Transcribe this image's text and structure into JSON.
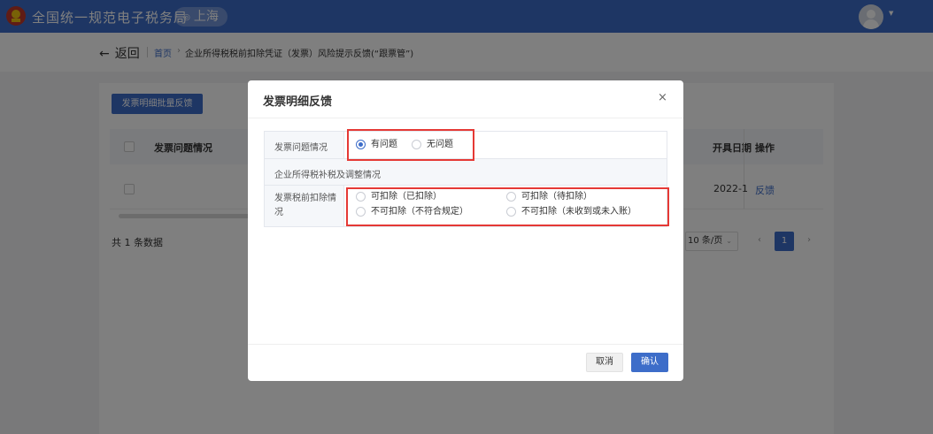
{
  "header": {
    "site_title": "全国统一规范电子税务局",
    "region": "上海"
  },
  "breadcrumb": {
    "back_label": "返回",
    "home": "首页",
    "separator": "›",
    "page": "企业所得税税前扣除凭证（发票）风险提示反馈(“跟票管”)"
  },
  "toolbar": {
    "batch_feedback_label": "发票明细批量反馈"
  },
  "table": {
    "columns": [
      "发票问题情况",
      "开具日期",
      "操作"
    ],
    "rows": [
      {
        "date": "2022-1",
        "action": "反馈"
      }
    ],
    "total_text": "共 1 条数据"
  },
  "pagination": {
    "page_size": "10 条/页",
    "current_page": "1",
    "prev": "‹",
    "next": "›"
  },
  "modal": {
    "title": "发票明细反馈",
    "close": "×",
    "row1_label": "发票问题情况",
    "row1_options": [
      {
        "label": "有问题",
        "selected": true
      },
      {
        "label": "无问题",
        "selected": false
      }
    ],
    "row2_label": "企业所得税补税及调整情况",
    "row3_label": "发票税前扣除情况",
    "row3_options": [
      {
        "label": "可扣除（已扣除）",
        "selected": false
      },
      {
        "label": "可扣除（待扣除）",
        "selected": false
      },
      {
        "label": "不可扣除（不符合规定）",
        "selected": false
      },
      {
        "label": "不可扣除（未收到或未入账）",
        "selected": false
      }
    ],
    "cancel_label": "取消",
    "confirm_label": "确认"
  },
  "colors": {
    "primary": "#3d6dc9",
    "highlight": "#e53935"
  }
}
